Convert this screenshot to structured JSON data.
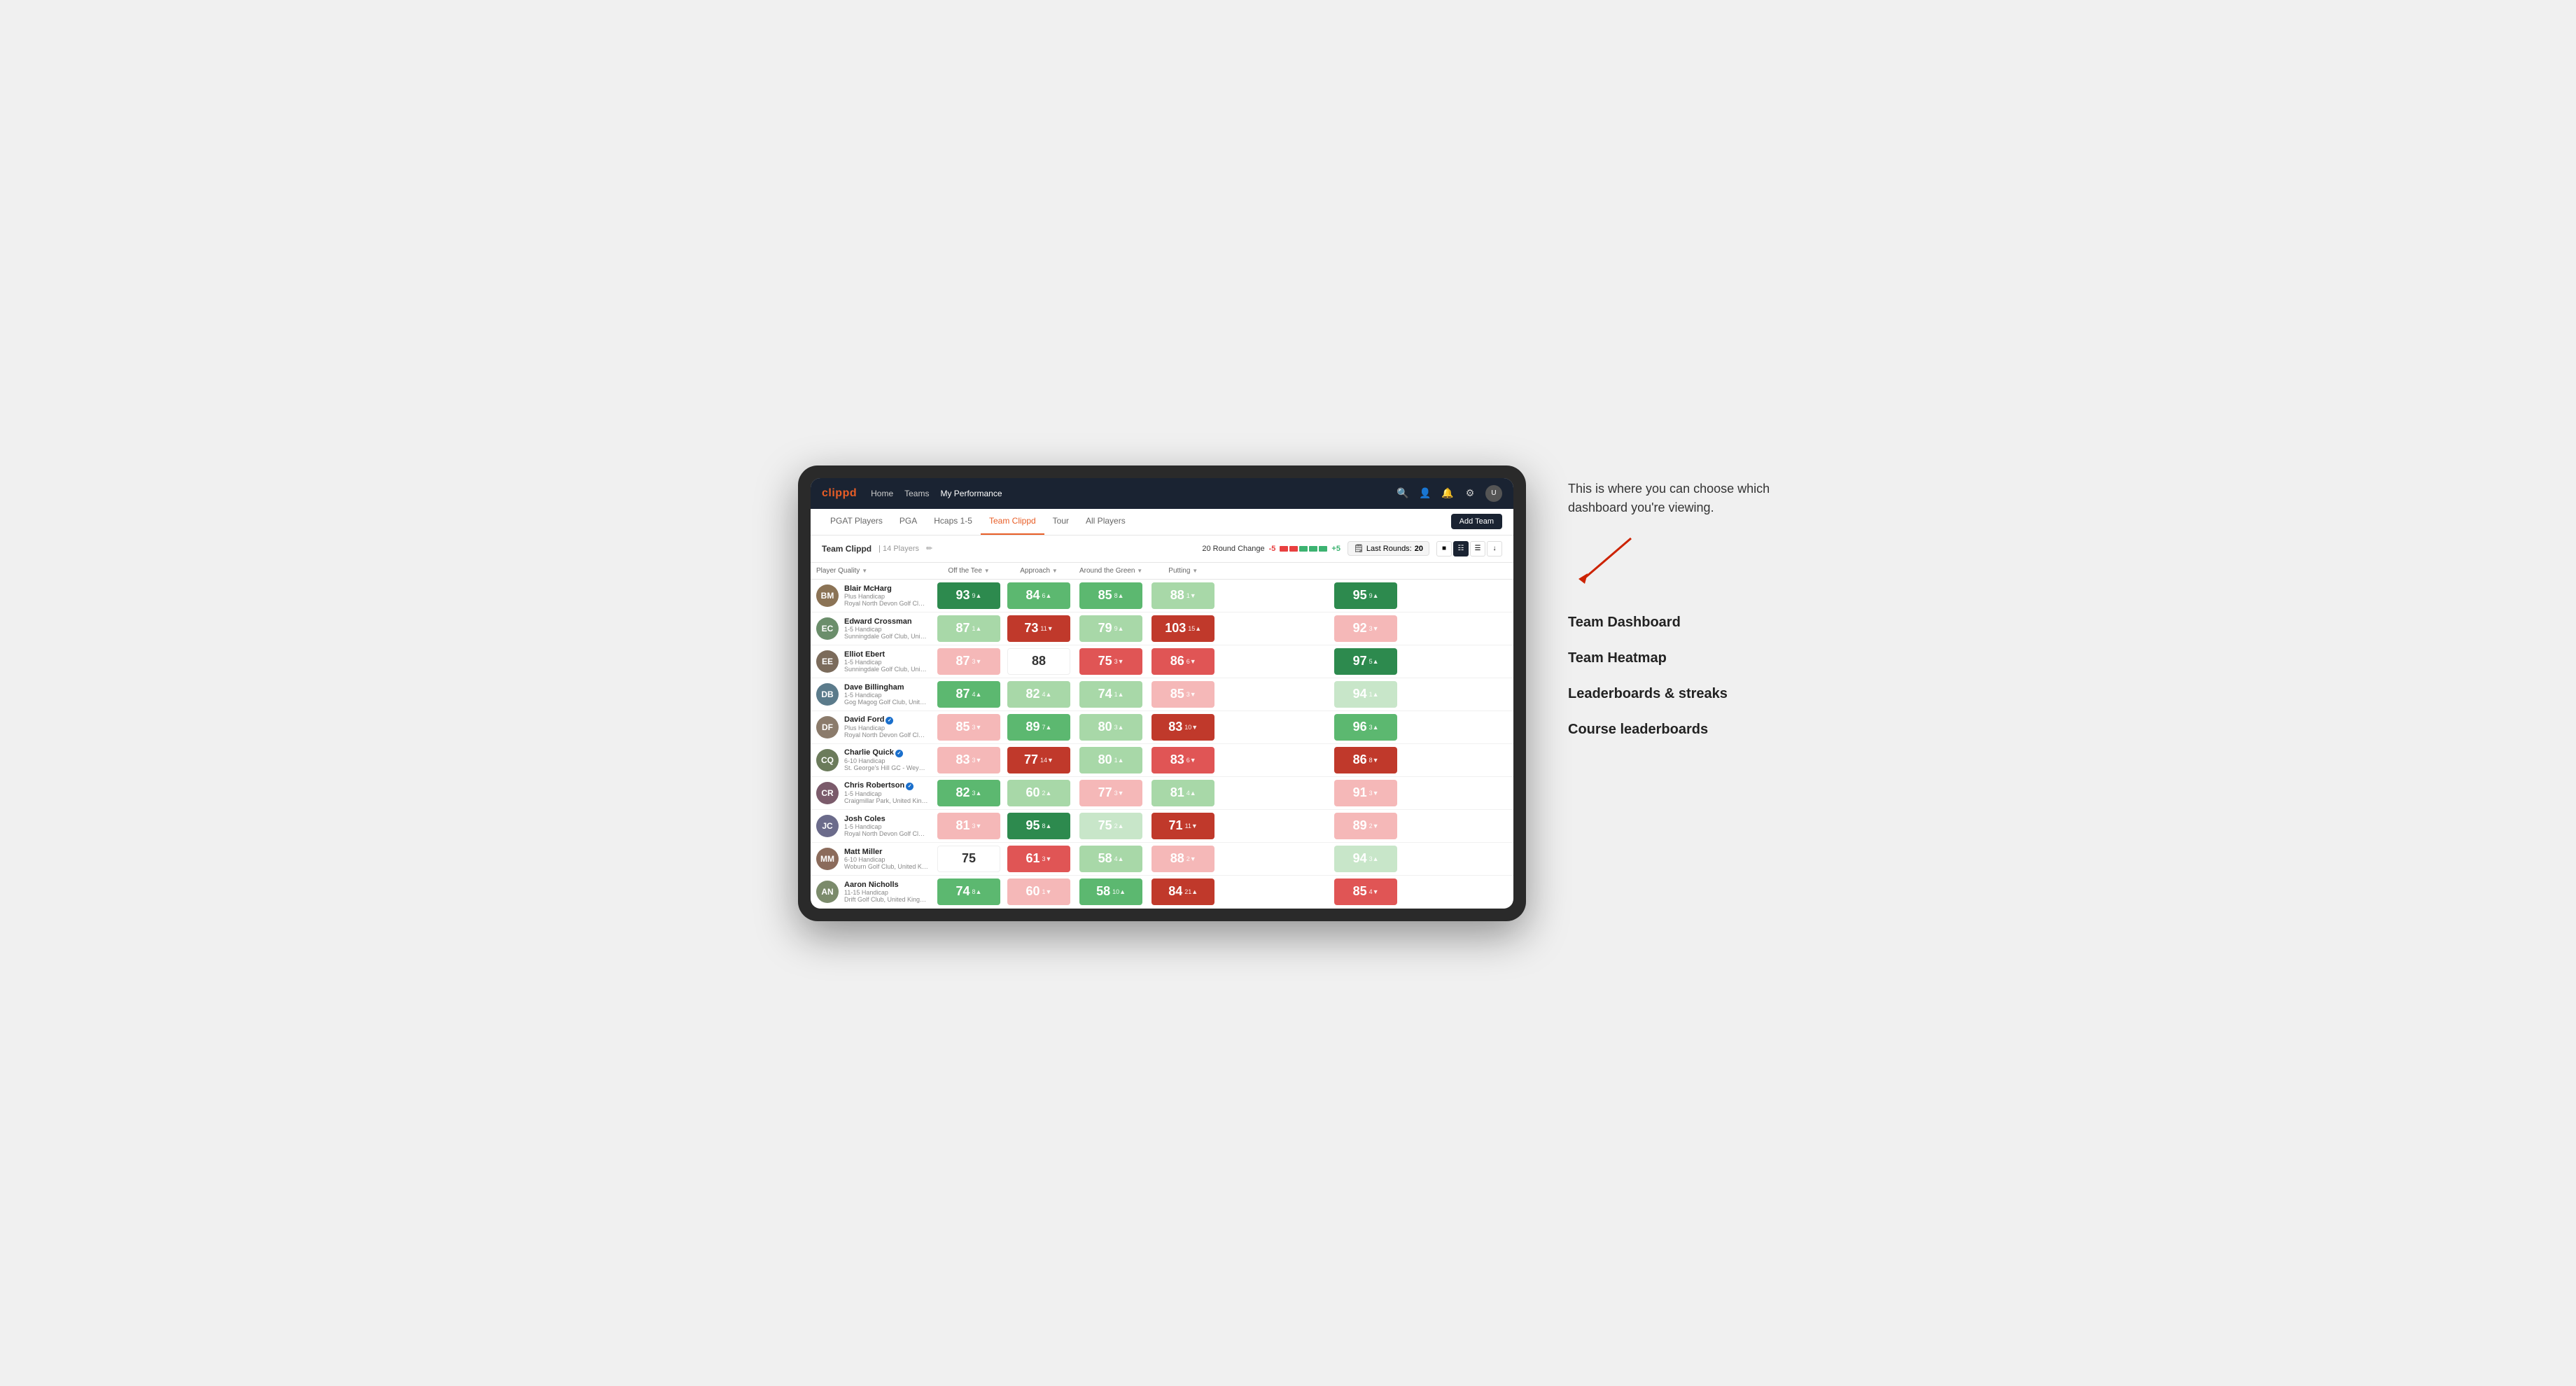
{
  "annotation": {
    "description": "This is where you can choose which dashboard you're viewing.",
    "menu_items": [
      "Team Dashboard",
      "Team Heatmap",
      "Leaderboards & streaks",
      "Course leaderboards"
    ]
  },
  "nav": {
    "logo": "clippd",
    "links": [
      "Home",
      "Teams",
      "My Performance"
    ],
    "active_link": "My Performance"
  },
  "sub_nav": {
    "tabs": [
      "PGAT Players",
      "PGA",
      "Hcaps 1-5",
      "Team Clippd",
      "Tour",
      "All Players"
    ],
    "active_tab": "Team Clippd",
    "add_team_label": "Add Team"
  },
  "team_header": {
    "title": "Team Clippd",
    "separator": "|",
    "count": "14 Players",
    "round_change_label": "20 Round Change",
    "minus_value": "-5",
    "plus_value": "+5",
    "last_rounds_label": "Last Rounds:",
    "last_rounds_value": "20"
  },
  "table": {
    "columns": {
      "player": "Player Quality",
      "off_tee": "Off the Tee",
      "approach": "Approach",
      "around_green": "Around the Green",
      "putting": "Putting"
    },
    "rows": [
      {
        "name": "Blair McHarg",
        "handicap": "Plus Handicap",
        "club": "Royal North Devon Golf Club, United Kingdom",
        "initials": "BM",
        "avatar_color": "#8B7355",
        "scores": {
          "quality": {
            "value": "93",
            "change": "9",
            "direction": "up",
            "color": "dark-green"
          },
          "off_tee": {
            "value": "84",
            "change": "6",
            "direction": "up",
            "color": "med-green"
          },
          "approach": {
            "value": "85",
            "change": "8",
            "direction": "up",
            "color": "med-green"
          },
          "around_green": {
            "value": "88",
            "change": "1",
            "direction": "down",
            "color": "light-green"
          },
          "putting": {
            "value": "95",
            "change": "9",
            "direction": "up",
            "color": "dark-green"
          }
        }
      },
      {
        "name": "Edward Crossman",
        "handicap": "1-5 Handicap",
        "club": "Sunningdale Golf Club, United Kingdom",
        "initials": "EC",
        "avatar_color": "#6B8E6B",
        "scores": {
          "quality": {
            "value": "87",
            "change": "1",
            "direction": "up",
            "color": "light-green"
          },
          "off_tee": {
            "value": "73",
            "change": "11",
            "direction": "down",
            "color": "dark-red"
          },
          "approach": {
            "value": "79",
            "change": "9",
            "direction": "up",
            "color": "light-green"
          },
          "around_green": {
            "value": "103",
            "change": "15",
            "direction": "up",
            "color": "dark-red"
          },
          "putting": {
            "value": "92",
            "change": "3",
            "direction": "down",
            "color": "light-pink"
          }
        }
      },
      {
        "name": "Elliot Ebert",
        "handicap": "1-5 Handicap",
        "club": "Sunningdale Golf Club, United Kingdom",
        "initials": "EE",
        "avatar_color": "#7B6B5B",
        "scores": {
          "quality": {
            "value": "87",
            "change": "3",
            "direction": "down",
            "color": "light-pink"
          },
          "off_tee": {
            "value": "88",
            "change": "",
            "direction": "none",
            "color": "white"
          },
          "approach": {
            "value": "75",
            "change": "3",
            "direction": "down",
            "color": "med-red"
          },
          "around_green": {
            "value": "86",
            "change": "6",
            "direction": "down",
            "color": "med-red"
          },
          "putting": {
            "value": "97",
            "change": "5",
            "direction": "up",
            "color": "dark-green"
          }
        }
      },
      {
        "name": "Dave Billingham",
        "handicap": "1-5 Handicap",
        "club": "Gog Magog Golf Club, United Kingdom",
        "initials": "DB",
        "avatar_color": "#5B7B8B",
        "scores": {
          "quality": {
            "value": "87",
            "change": "4",
            "direction": "up",
            "color": "med-green"
          },
          "off_tee": {
            "value": "82",
            "change": "4",
            "direction": "up",
            "color": "light-green"
          },
          "approach": {
            "value": "74",
            "change": "1",
            "direction": "up",
            "color": "light-green"
          },
          "around_green": {
            "value": "85",
            "change": "3",
            "direction": "down",
            "color": "light-pink"
          },
          "putting": {
            "value": "94",
            "change": "1",
            "direction": "up",
            "color": "pale-green"
          }
        }
      },
      {
        "name": "David Ford",
        "handicap": "Plus Handicap",
        "club": "Royal North Devon Golf Club, United Kingdom",
        "initials": "DF",
        "avatar_color": "#8B7B6B",
        "verified": true,
        "scores": {
          "quality": {
            "value": "85",
            "change": "3",
            "direction": "down",
            "color": "light-pink"
          },
          "off_tee": {
            "value": "89",
            "change": "7",
            "direction": "up",
            "color": "med-green"
          },
          "approach": {
            "value": "80",
            "change": "3",
            "direction": "up",
            "color": "light-green"
          },
          "around_green": {
            "value": "83",
            "change": "10",
            "direction": "down",
            "color": "dark-red"
          },
          "putting": {
            "value": "96",
            "change": "3",
            "direction": "up",
            "color": "med-green"
          }
        }
      },
      {
        "name": "Charlie Quick",
        "handicap": "6-10 Handicap",
        "club": "St. George's Hill GC - Weybridge - Surrey, Uni...",
        "initials": "CQ",
        "avatar_color": "#6B7B5B",
        "verified": true,
        "scores": {
          "quality": {
            "value": "83",
            "change": "3",
            "direction": "down",
            "color": "light-pink"
          },
          "off_tee": {
            "value": "77",
            "change": "14",
            "direction": "down",
            "color": "dark-red"
          },
          "approach": {
            "value": "80",
            "change": "1",
            "direction": "up",
            "color": "light-green"
          },
          "around_green": {
            "value": "83",
            "change": "6",
            "direction": "down",
            "color": "med-red"
          },
          "putting": {
            "value": "86",
            "change": "8",
            "direction": "down",
            "color": "dark-red"
          }
        }
      },
      {
        "name": "Chris Robertson",
        "handicap": "1-5 Handicap",
        "club": "Craigmillar Park, United Kingdom",
        "initials": "CR",
        "avatar_color": "#7B5B6B",
        "verified": true,
        "scores": {
          "quality": {
            "value": "82",
            "change": "3",
            "direction": "up",
            "color": "med-green"
          },
          "off_tee": {
            "value": "60",
            "change": "2",
            "direction": "up",
            "color": "light-green"
          },
          "approach": {
            "value": "77",
            "change": "3",
            "direction": "down",
            "color": "light-pink"
          },
          "around_green": {
            "value": "81",
            "change": "4",
            "direction": "up",
            "color": "light-green"
          },
          "putting": {
            "value": "91",
            "change": "3",
            "direction": "down",
            "color": "light-pink"
          }
        }
      },
      {
        "name": "Josh Coles",
        "handicap": "1-5 Handicap",
        "club": "Royal North Devon Golf Club, United Kingdom",
        "initials": "JC",
        "avatar_color": "#6B6B8B",
        "scores": {
          "quality": {
            "value": "81",
            "change": "3",
            "direction": "down",
            "color": "light-pink"
          },
          "off_tee": {
            "value": "95",
            "change": "8",
            "direction": "up",
            "color": "dark-green"
          },
          "approach": {
            "value": "75",
            "change": "2",
            "direction": "up",
            "color": "pale-green"
          },
          "around_green": {
            "value": "71",
            "change": "11",
            "direction": "down",
            "color": "dark-red"
          },
          "putting": {
            "value": "89",
            "change": "2",
            "direction": "down",
            "color": "light-pink"
          }
        }
      },
      {
        "name": "Matt Miller",
        "handicap": "6-10 Handicap",
        "club": "Woburn Golf Club, United Kingdom",
        "initials": "MM",
        "avatar_color": "#8B6B5B",
        "scores": {
          "quality": {
            "value": "75",
            "change": "",
            "direction": "none",
            "color": "white"
          },
          "off_tee": {
            "value": "61",
            "change": "3",
            "direction": "down",
            "color": "med-red"
          },
          "approach": {
            "value": "58",
            "change": "4",
            "direction": "up",
            "color": "light-green"
          },
          "around_green": {
            "value": "88",
            "change": "2",
            "direction": "down",
            "color": "light-pink"
          },
          "putting": {
            "value": "94",
            "change": "3",
            "direction": "up",
            "color": "pale-green"
          }
        }
      },
      {
        "name": "Aaron Nicholls",
        "handicap": "11-15 Handicap",
        "club": "Drift Golf Club, United Kingdom",
        "initials": "AN",
        "avatar_color": "#7B8B6B",
        "scores": {
          "quality": {
            "value": "74",
            "change": "8",
            "direction": "up",
            "color": "med-green"
          },
          "off_tee": {
            "value": "60",
            "change": "1",
            "direction": "down",
            "color": "light-pink"
          },
          "approach": {
            "value": "58",
            "change": "10",
            "direction": "up",
            "color": "med-green"
          },
          "around_green": {
            "value": "84",
            "change": "21",
            "direction": "up",
            "color": "dark-red"
          },
          "putting": {
            "value": "85",
            "change": "4",
            "direction": "down",
            "color": "med-red"
          }
        }
      }
    ]
  }
}
